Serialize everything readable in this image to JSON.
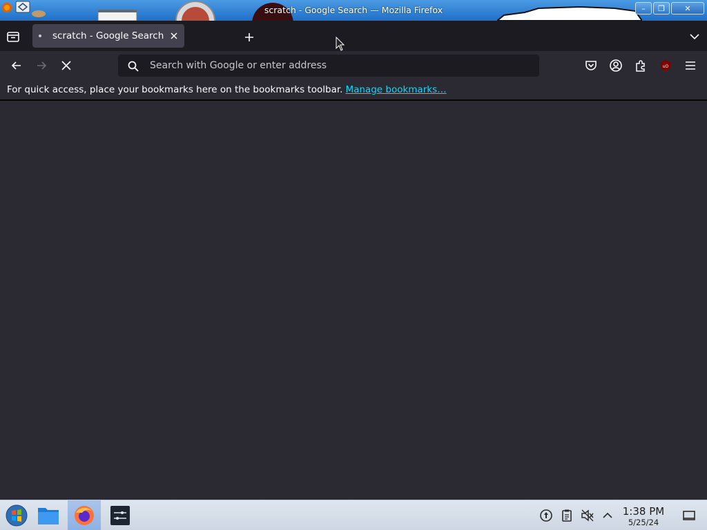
{
  "window": {
    "title": "scratch - Google Search — Mozilla Firefox",
    "minimize_label": "–",
    "maximize_label": "❐",
    "close_label": "✕"
  },
  "tabs": [
    {
      "title": "scratch - Google Search",
      "active": true,
      "loading": true
    }
  ],
  "navbar": {
    "urlbar_placeholder": "Search with Google or enter address",
    "urlbar_value": ""
  },
  "bookmarks_bar": {
    "message": "For quick access, place your bookmarks here on the bookmarks toolbar.",
    "manage_link": "Manage bookmarks…"
  },
  "taskbar": {
    "time": "1:38 PM",
    "date": "5/25/24"
  },
  "icons": {
    "tab_list": "tab-list-icon",
    "new_tab": "plus-icon",
    "back": "back-arrow-icon",
    "forward": "forward-arrow-icon",
    "stop": "stop-x-icon",
    "search": "search-icon",
    "pocket": "pocket-icon",
    "account": "account-icon",
    "extensions": "extensions-puzzle-icon",
    "ublock": "ublock-origin-icon",
    "menu": "hamburger-menu-icon"
  },
  "colors": {
    "tabstrip_bg": "#1c1b22",
    "toolbar_bg": "#2b2a33",
    "active_tab_bg": "#42414d",
    "link": "#00ddff",
    "titlebar": "#1f6fc8",
    "taskbar": "#d6dee8"
  }
}
